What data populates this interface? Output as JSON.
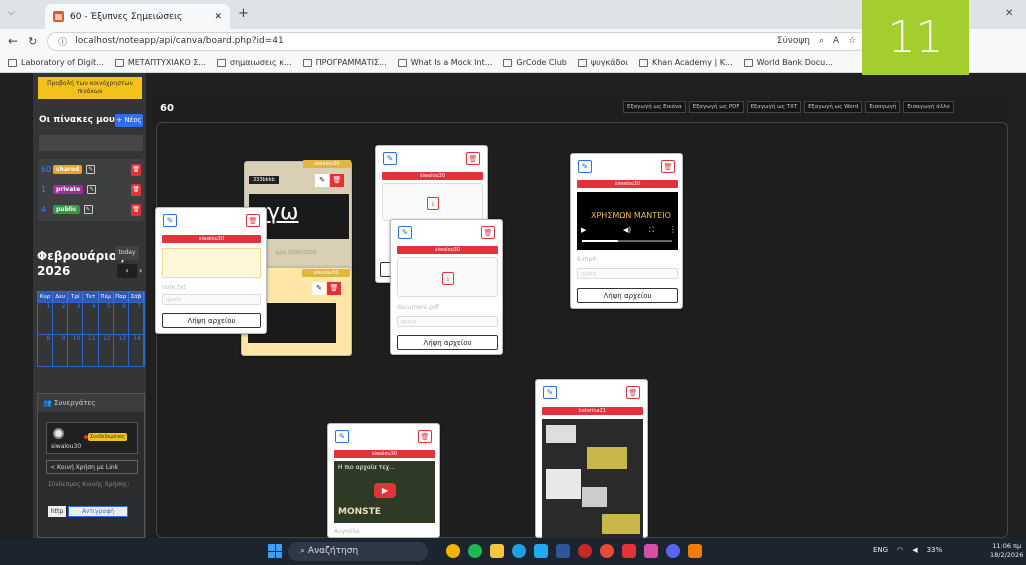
{
  "browser": {
    "tab_title": "60 - Έξυπνες Σημειώσεις",
    "url": "localhost/noteapp/api/canva/board.php?id=41",
    "sync_label": "Σύνοψη",
    "bookmarks": [
      "Laboratory of Digit...",
      "ΜΕΤΑΠΤΥΧΙΑΚΟ Σ...",
      "σημαιωσεις κ...",
      "ΠΡΟΓΡΑΜΜΑΤΙΣ...",
      "What Is a Mock Int...",
      "GrCode Club",
      "ψυγκάδοι",
      "Khan Academy | K...",
      "World Bank Docu..."
    ],
    "overlay_number": "11"
  },
  "sidebar": {
    "shared_button": "Προβολή των κοινόχρηστων πινάκων",
    "my_boards": "Οι πίνακες μου",
    "new_button": "+ Νέος",
    "boards": [
      {
        "num": "60",
        "badge": "shared",
        "color": "#f3a21a"
      },
      {
        "num": "1",
        "badge": "private",
        "color": "#a22ba2"
      },
      {
        "num": "4",
        "badge": "public",
        "color": "#2e9a45"
      }
    ],
    "calendar": {
      "title": "Φεβρουάριος 2026",
      "today": "today",
      "days": [
        "Κυρ",
        "Δευ",
        "Τρί",
        "Τετ",
        "Πέμ",
        "Παρ",
        "Σάβ"
      ],
      "weeks": [
        [
          "1",
          "2",
          "3",
          "4",
          "5",
          "6",
          "7"
        ],
        [
          "8",
          "9",
          "10",
          "11",
          "12",
          "13",
          "14"
        ]
      ]
    },
    "collab": {
      "title": "Συνεργάτες",
      "user": "siwalou30",
      "status": "Συνδεδεμένος",
      "share_button": "Κοινή Χρήση με Link",
      "share_label": "Σύνδεσμος Κοινής Χρήσης:",
      "http": "http",
      "copy": "Αντιγραφή"
    }
  },
  "board": {
    "title": "60",
    "exports": [
      "Εξαγωγή ως Εικόνα",
      "Εξαγωγή ως PDF",
      "Εξαγωγή ως TXT",
      "Εξαγωγή ως Word",
      "Εισαγωγή",
      "Εισαγωγή άλλο"
    ],
    "cards": {
      "beige_user": "siwalou30",
      "beige_text": "333bkkb",
      "beige_big": "γω",
      "beige_date": "ημ/α 10/01/2026",
      "yellow_user": "siwalou30",
      "note_user": "siwalou30",
      "note_file": "note.txt",
      "note_input": "ημνέα",
      "pdf1_user": "siwalou30",
      "pdf2_user": "siwalou30",
      "pdf2_file": "document.pdf",
      "pdf2_input": "ημνέα",
      "video_user": "siwalou30",
      "video_text": "ΧΡΗΣΜΩΝ ΜΑΝΤΕΙΟ",
      "video_file": "6.mp4",
      "video_input": "ημνέα",
      "yt_user": "siwalou30",
      "yt_title": "Η πιο αρχαία τεχ...",
      "yt_sub": "MONSTE",
      "yt_label": "Αυγούλα",
      "shot_user": "katerina21",
      "download": "Λήψη αρχείου"
    }
  },
  "taskbar": {
    "search": "Αναζήτηση",
    "lang": "ENG",
    "battery": "33%",
    "time": "11:06 πμ",
    "date": "18/2/2026"
  }
}
